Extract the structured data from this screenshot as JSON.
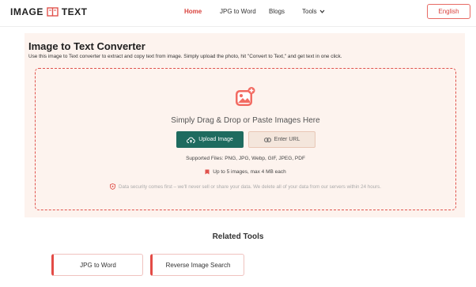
{
  "header": {
    "logo_left": "IMAGE",
    "logo_right": "TEXT",
    "nav": [
      {
        "label": "Home"
      },
      {
        "label": "JPG to Word"
      },
      {
        "label": "Blogs"
      },
      {
        "label": "Tools"
      }
    ],
    "language": "English"
  },
  "main": {
    "title": "Image to Text Converter",
    "description": "Use this image to Text converter to extract and copy text from image. Simply upload the photo, hit \"Convert to Text,\" and get text in one click.",
    "dropzone": {
      "prompt": "Simply Drag & Drop or Paste Images Here",
      "upload_label": "Upload Image",
      "url_label": "Enter URL",
      "supported_files": "Supported Files: PNG, JPG, Webp, GIF, JPEG, PDF",
      "limit": "Up to 5 images, max 4 MB each",
      "security": "Data security comes first – we'll never sell or share your data. We delete all of your data from our servers within 24 hours."
    }
  },
  "related": {
    "title": "Related Tools",
    "tools": [
      {
        "label": "JPG to Word"
      },
      {
        "label": "Reverse Image Search"
      }
    ]
  },
  "colors": {
    "accent": "#d9433e",
    "primary_button": "#1e6b5f",
    "card_bg": "#fdf3ee"
  },
  "icons": [
    "logo-icon",
    "chevron-down-icon",
    "image-upload-icon",
    "cloud-upload-icon",
    "link-icon",
    "bookmark-icon",
    "shield-icon"
  ]
}
